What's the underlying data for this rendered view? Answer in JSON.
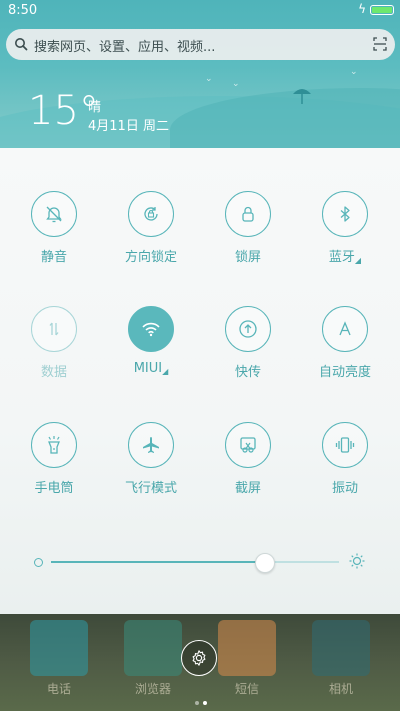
{
  "status_bar": {
    "time": "8:50",
    "battery_level": 1.0
  },
  "search": {
    "placeholder": "搜索网页、设置、应用、视频..."
  },
  "weather": {
    "temperature": "15°",
    "condition": "晴",
    "date": "4月11日 周二"
  },
  "toggles": [
    {
      "label": "静音",
      "icon": "bell-off-icon",
      "state": "off"
    },
    {
      "label": "方向锁定",
      "icon": "rotation-lock-icon",
      "state": "off"
    },
    {
      "label": "锁屏",
      "icon": "lock-icon",
      "state": "off"
    },
    {
      "label": "蓝牙",
      "icon": "bluetooth-icon",
      "state": "off",
      "expandable": true
    },
    {
      "label": "数据",
      "icon": "mobile-data-icon",
      "state": "disabled"
    },
    {
      "label": "MIUI",
      "icon": "wifi-icon",
      "state": "on",
      "expandable": true
    },
    {
      "label": "快传",
      "icon": "share-icon",
      "state": "off"
    },
    {
      "label": "自动亮度",
      "icon": "auto-brightness-icon",
      "state": "off"
    },
    {
      "label": "手电筒",
      "icon": "flashlight-icon",
      "state": "off"
    },
    {
      "label": "飞行模式",
      "icon": "airplane-icon",
      "state": "off"
    },
    {
      "label": "截屏",
      "icon": "screenshot-icon",
      "state": "off"
    },
    {
      "label": "振动",
      "icon": "vibrate-icon",
      "state": "off"
    }
  ],
  "brightness": {
    "level": 0.74
  },
  "dock": {
    "apps": [
      {
        "label": "电话",
        "icon": "phone-icon"
      },
      {
        "label": "浏览器",
        "icon": "browser-icon"
      },
      {
        "label": "短信",
        "icon": "messages-icon"
      },
      {
        "label": "相机",
        "icon": "camera-icon"
      }
    ],
    "page_count": 2,
    "current_page": 2
  },
  "colors": {
    "accent": "#58b5b9",
    "header": "#4fb4ba",
    "battery": "#6ee86e"
  }
}
